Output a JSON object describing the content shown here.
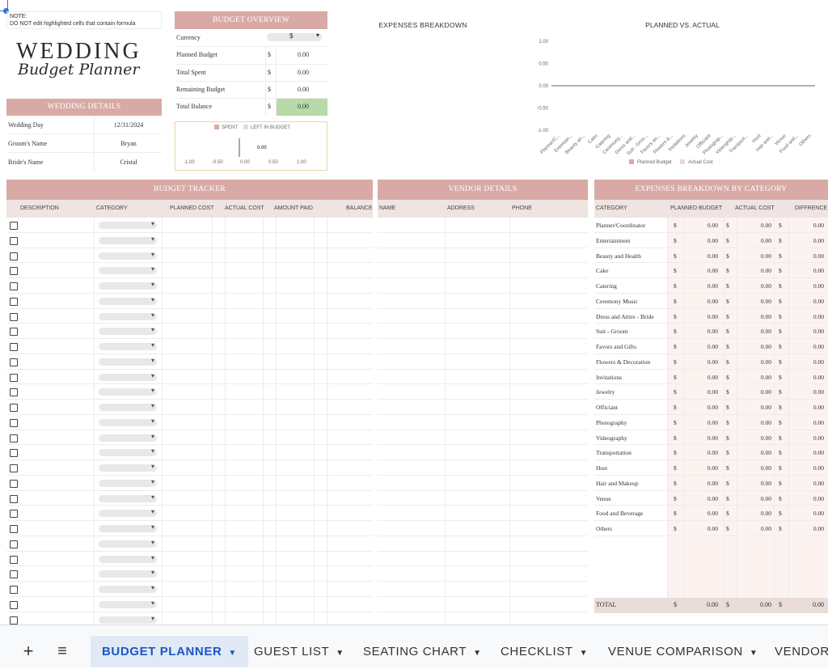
{
  "note": {
    "line1": "NOTE:",
    "line2": "DO NOT edit highlighted cells that contain formula"
  },
  "logo": {
    "line1": "WEDDING",
    "line2": "Budget Planner"
  },
  "wedding_details": {
    "header": "WEDDING DETAILS",
    "rows": [
      {
        "label": "Wedding Day",
        "value": "12/31/2024"
      },
      {
        "label": "Groom's Name",
        "value": "Bryan"
      },
      {
        "label": "Bride's Name",
        "value": "Cristal"
      }
    ]
  },
  "budget_overview": {
    "header": "BUDGET OVERVIEW",
    "currency_label": "Currency",
    "currency_value": "$",
    "rows": [
      {
        "label": "Planned Budget",
        "sym": "$",
        "value": "0.00"
      },
      {
        "label": "Total Spent",
        "sym": "$",
        "value": "0.00"
      },
      {
        "label": "Remaining Budget",
        "sym": "$",
        "value": "0.00"
      },
      {
        "label": "Total Balance",
        "sym": "$",
        "value": "0.00"
      }
    ],
    "mini_chart": {
      "legend": [
        "SPENT",
        "LEFT IN BUDGET"
      ],
      "center_value": "0.00",
      "ticks": [
        "-1.00",
        "-0.50",
        "0.00",
        "0.50",
        "1.00"
      ],
      "colors": {
        "spent": "#d9aaa5",
        "left": "#ead8d6"
      }
    }
  },
  "expenses_breakdown_title": "EXPENSES BREAKDOWN",
  "planned_vs_actual": {
    "title": "PLANNED VS. ACTUAL",
    "y_ticks": [
      "1.00",
      "0.50",
      "0.00",
      "-0.50",
      "-1.00"
    ],
    "x_labels": [
      "Planner/C...",
      "Entertain...",
      "Beauty an...",
      "Cake",
      "Catering",
      "Ceremony...",
      "Dress and...",
      "Suit - Groo...",
      "Favors an...",
      "Flowers &...",
      "Invitations",
      "Jewelry",
      "Officiant",
      "Photograp...",
      "Videograp...",
      "Transport...",
      "Host",
      "Hair and...",
      "Venue",
      "Food and...",
      "Others"
    ],
    "legend": [
      "Planned Budget",
      "Actual Cost"
    ],
    "colors": {
      "planned": "#d9aaa5",
      "actual": "#ead8d6"
    }
  },
  "chart_data": {
    "type": "bar",
    "title": "PLANNED VS. ACTUAL",
    "categories": [
      "Planner/C...",
      "Entertain...",
      "Beauty an...",
      "Cake",
      "Catering",
      "Ceremony...",
      "Dress and...",
      "Suit - Groo...",
      "Favors an...",
      "Flowers &...",
      "Invitations",
      "Jewelry",
      "Officiant",
      "Photograp...",
      "Videograp...",
      "Transport...",
      "Host",
      "Hair and...",
      "Venue",
      "Food and...",
      "Others"
    ],
    "series": [
      {
        "name": "Planned Budget",
        "values": [
          0,
          0,
          0,
          0,
          0,
          0,
          0,
          0,
          0,
          0,
          0,
          0,
          0,
          0,
          0,
          0,
          0,
          0,
          0,
          0,
          0
        ]
      },
      {
        "name": "Actual Cost",
        "values": [
          0,
          0,
          0,
          0,
          0,
          0,
          0,
          0,
          0,
          0,
          0,
          0,
          0,
          0,
          0,
          0,
          0,
          0,
          0,
          0,
          0
        ]
      }
    ],
    "ylim": [
      -1,
      1
    ],
    "legend_position": "bottom"
  },
  "budget_tracker": {
    "header": "BUDGET TRACKER",
    "columns": [
      "DESCRIPTION",
      "CATEGORY",
      "PLANNED COST",
      "ACTUAL COST",
      "AMOUNT PAID",
      "BALANCE"
    ]
  },
  "vendor_details": {
    "header": "VENDOR DETAILS",
    "columns": [
      "NAME",
      "ADDRESS",
      "PHONE"
    ]
  },
  "category_breakdown": {
    "header": "EXPENSES BREAKDOWN BY CATEGORY",
    "columns": [
      "CATEGORY",
      "PLANNED BUDGET",
      "ACTUAL COST",
      "DIFFRENCE"
    ],
    "rows": [
      {
        "name": "Planner/Coordinator",
        "planned": "0.00",
        "actual": "0.00",
        "diff": "0.00"
      },
      {
        "name": "Entertainment",
        "planned": "0.00",
        "actual": "0.00",
        "diff": "0.00"
      },
      {
        "name": "Beauty and Health",
        "planned": "0.00",
        "actual": "0.00",
        "diff": "0.00"
      },
      {
        "name": "Cake",
        "planned": "0.00",
        "actual": "0.00",
        "diff": "0.00"
      },
      {
        "name": "Catering",
        "planned": "0.00",
        "actual": "0.00",
        "diff": "0.00"
      },
      {
        "name": "Ceremony Music",
        "planned": "0.00",
        "actual": "0.00",
        "diff": "0.00"
      },
      {
        "name": "Dress and Attire - Bride",
        "planned": "0.00",
        "actual": "0.00",
        "diff": "0.00"
      },
      {
        "name": "Suit - Groom",
        "planned": "0.00",
        "actual": "0.00",
        "diff": "0.00"
      },
      {
        "name": "Favors and Gifts",
        "planned": "0.00",
        "actual": "0.00",
        "diff": "0.00"
      },
      {
        "name": "Flowers & Decoration",
        "planned": "0.00",
        "actual": "0.00",
        "diff": "0.00"
      },
      {
        "name": "Invitations",
        "planned": "0.00",
        "actual": "0.00",
        "diff": "0.00"
      },
      {
        "name": "Jewelry",
        "planned": "0.00",
        "actual": "0.00",
        "diff": "0.00"
      },
      {
        "name": "Officiant",
        "planned": "0.00",
        "actual": "0.00",
        "diff": "0.00"
      },
      {
        "name": "Photography",
        "planned": "0.00",
        "actual": "0.00",
        "diff": "0.00"
      },
      {
        "name": "Videography",
        "planned": "0.00",
        "actual": "0.00",
        "diff": "0.00"
      },
      {
        "name": "Transportation",
        "planned": "0.00",
        "actual": "0.00",
        "diff": "0.00"
      },
      {
        "name": "Host",
        "planned": "0.00",
        "actual": "0.00",
        "diff": "0.00"
      },
      {
        "name": "Hair and Makeup",
        "planned": "0.00",
        "actual": "0.00",
        "diff": "0.00"
      },
      {
        "name": "Venue",
        "planned": "0.00",
        "actual": "0.00",
        "diff": "0.00"
      },
      {
        "name": "Food and Beverage",
        "planned": "0.00",
        "actual": "0.00",
        "diff": "0.00"
      },
      {
        "name": "Others",
        "planned": "0.00",
        "actual": "0.00",
        "diff": "0.00"
      }
    ],
    "total": {
      "label": "TOTAL",
      "planned": "0.00",
      "actual": "0.00",
      "diff": "0.00"
    },
    "currency": "$"
  },
  "tabs": {
    "add_icon": "+",
    "menu_icon": "≡",
    "items": [
      {
        "label": "BUDGET PLANNER",
        "active": true
      },
      {
        "label": "GUEST LIST",
        "active": false
      },
      {
        "label": "SEATING CHART",
        "active": false
      },
      {
        "label": "CHECKLIST",
        "active": false
      },
      {
        "label": "VENUE COMPARISON",
        "active": false
      },
      {
        "label": "VENDOR",
        "active": false
      }
    ]
  },
  "colors": {
    "header": "#d9aaa5",
    "subheader": "#efe4e1",
    "balance": "#b8d9a8",
    "category_bg": "#fcf3f0",
    "active_tab": "#e1e9f7",
    "active_tab_text": "#1a56c4"
  }
}
